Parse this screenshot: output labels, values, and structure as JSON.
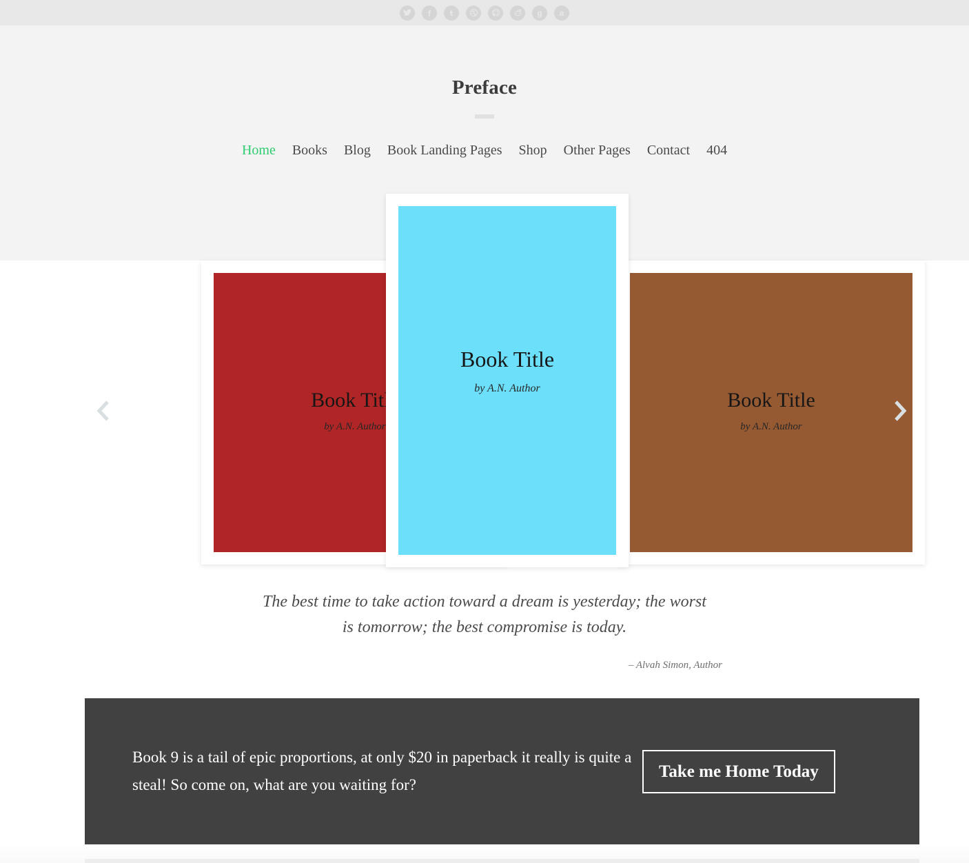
{
  "social": {
    "items": [
      {
        "name": "twitter-icon",
        "glyph": "t"
      },
      {
        "name": "facebook-icon",
        "glyph": "f"
      },
      {
        "name": "tumblr-icon",
        "glyph": "YU"
      },
      {
        "name": "dribbble-icon",
        "glyph": "d"
      },
      {
        "name": "github-icon",
        "glyph": "o"
      },
      {
        "name": "reddit-icon",
        "glyph": "r"
      },
      {
        "name": "goodreads-icon",
        "glyph": "g"
      },
      {
        "name": "amazon-icon",
        "glyph": "a"
      }
    ]
  },
  "header": {
    "title": "Preface",
    "nav": [
      {
        "label": "Home",
        "active": true
      },
      {
        "label": "Books",
        "active": false
      },
      {
        "label": "Blog",
        "active": false
      },
      {
        "label": "Book Landing Pages",
        "active": false
      },
      {
        "label": "Shop",
        "active": false
      },
      {
        "label": "Other Pages",
        "active": false
      },
      {
        "label": "Contact",
        "active": false
      },
      {
        "label": "404",
        "active": false
      }
    ],
    "active_color": "#2ecc71"
  },
  "carousel": {
    "prev_label": "‹",
    "next_label": "›",
    "books": [
      {
        "title": "Book Title",
        "author": "by A.N. Author",
        "color": "#b02525"
      },
      {
        "title": "Book Title",
        "author": "by A.N. Author",
        "color": "#6ce0fb"
      },
      {
        "title": "Book Title",
        "author": "by A.N. Author",
        "color": "#965a33"
      }
    ]
  },
  "quote": {
    "text": "The best time to take action toward a dream is yesterday; the worst is tomorrow; the best compromise is today.",
    "attribution": "– Alvah Simon, Author"
  },
  "cta": {
    "text": "Book 9 is a tail of epic proportions, at only $20 in paperback it really is quite a steal! So come on, what are you waiting for?",
    "button_label": "Take me Home Today",
    "background": "#414141"
  }
}
